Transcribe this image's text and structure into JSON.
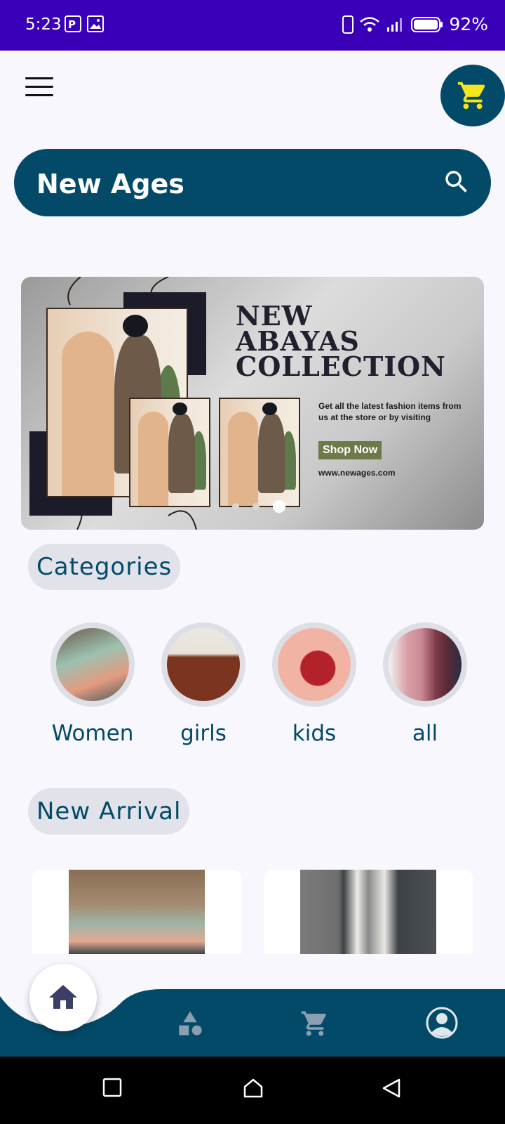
{
  "status": {
    "time": "5:23",
    "battery": "92%"
  },
  "header": {
    "menu_icon": "hamburger-menu-icon",
    "cart_icon": "shopping-cart-icon"
  },
  "search": {
    "title": "New Ages",
    "icon": "search-icon"
  },
  "banner": {
    "heading_line1": "NEW",
    "heading_line2": "ABAYAS",
    "heading_line3": "COLLECTION",
    "subtitle": "Get all the latest fashion items from us at the store or by visiting",
    "cta": "Shop Now",
    "website": "www.newages.com",
    "slides": 4,
    "active_slide": 4
  },
  "categories": {
    "title": "Categories",
    "items": [
      {
        "label": "Women"
      },
      {
        "label": "girls"
      },
      {
        "label": "kids"
      },
      {
        "label": "all"
      }
    ]
  },
  "new_arrival": {
    "title": "New Arrival"
  },
  "bottom_nav": {
    "items": [
      "home-icon",
      "categories-shapes-icon",
      "cart-icon",
      "profile-icon"
    ],
    "active": "home-icon"
  },
  "colors": {
    "primary": "#034a68",
    "status_bar": "#3a00b8",
    "cart_accent": "#f5e61c"
  }
}
